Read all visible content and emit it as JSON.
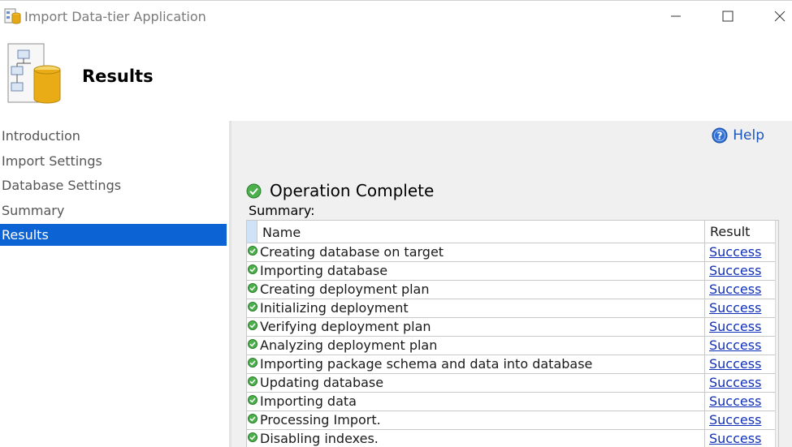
{
  "window": {
    "title": "Import Data-tier Application",
    "controls": [
      "minimize",
      "maximize",
      "close"
    ]
  },
  "header": {
    "title": "Results",
    "icon": "database-diagram-icon"
  },
  "sidebar": {
    "items": [
      {
        "label": "Introduction",
        "active": false
      },
      {
        "label": "Import Settings",
        "active": false
      },
      {
        "label": "Database Settings",
        "active": false
      },
      {
        "label": "Summary",
        "active": false
      },
      {
        "label": "Results",
        "active": true
      }
    ]
  },
  "help": {
    "label": "Help",
    "icon": "help-circle-icon"
  },
  "operation": {
    "status": "Operation Complete",
    "icon": "check-circle-icon"
  },
  "summary": {
    "label": "Summary:",
    "columns": {
      "name": "Name",
      "result": "Result"
    },
    "rows": [
      {
        "name": "Creating database on target",
        "result": "Success"
      },
      {
        "name": "Importing database",
        "result": "Success"
      },
      {
        "name": "Creating deployment plan",
        "result": "Success"
      },
      {
        "name": "Initializing deployment",
        "result": "Success"
      },
      {
        "name": "Verifying deployment plan",
        "result": "Success"
      },
      {
        "name": "Analyzing deployment plan",
        "result": "Success"
      },
      {
        "name": "Importing package schema and data into database",
        "result": "Success"
      },
      {
        "name": "Updating database",
        "result": "Success"
      },
      {
        "name": "Importing data",
        "result": "Success"
      },
      {
        "name": "Processing Import.",
        "result": "Success"
      },
      {
        "name": "Disabling indexes.",
        "result": "Success"
      }
    ]
  },
  "colors": {
    "accent": "#0c63d4",
    "link": "#1030b8",
    "success": "#3aa53a"
  }
}
